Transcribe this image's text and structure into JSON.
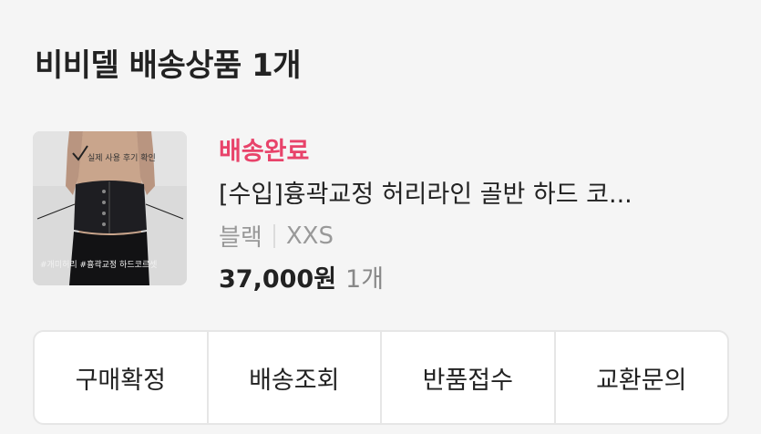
{
  "section": {
    "title": "비비델 배송상품 1개"
  },
  "product": {
    "thumbnail": {
      "caption_top": "실제 사용 후기 확인",
      "caption_bottom": "#개미허리 #흉곽교정 하드코르셋"
    },
    "status": "배송완료",
    "name": "[수입]흉곽교정 허리라인 골반 하드 코...",
    "option_color": "블랙",
    "option_size": "XXS",
    "price": "37,000원",
    "quantity": "1개"
  },
  "actions": {
    "confirm_purchase": "구매확정",
    "track_delivery": "배송조회",
    "request_return": "반품접수",
    "exchange_inquiry": "교환문의"
  },
  "colors": {
    "status": "#e8436a",
    "background": "#f5f5f5"
  }
}
